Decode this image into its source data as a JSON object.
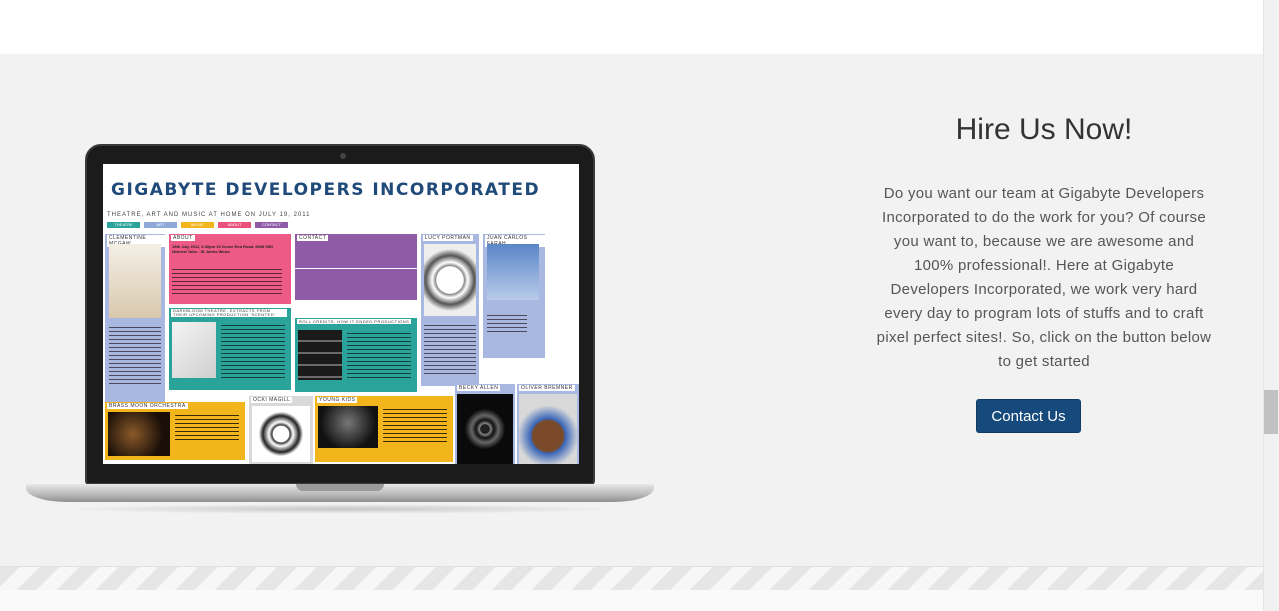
{
  "hire": {
    "title": "Hire Us Now!",
    "text": "Do you want our team at Gigabyte Developers Incorporated to do the work for you? Of course you want to, because we are awesome and 100% professional!. Here at Gigabyte Developers Incorporated, we work very hard every day to program lots of stuffs and to craft pixel perfect sites!. So, click on the button below to get started",
    "button_label": "Contact Us",
    "button_color": "#174a7c"
  },
  "laptop_screen": {
    "site_title": "Gigabyte Developers Incorporated",
    "subtitle": "THEATRE, ART AND MUSIC AT HOME ON JULY 19, 2011",
    "nav": [
      "THEATRE",
      "ART",
      "MUSIC",
      "ABOUT",
      "CONTACT"
    ],
    "blocks": {
      "clementine": "CLEMENTINE MCGAW",
      "about": "ABOUT",
      "about_text": "19th July 2011, 6.30pm 15 Grove End Road, NW8 9SD Nearest Tube : St Johns Wood",
      "contact": "CONTACT",
      "lucy": "LUCY PORTMAN",
      "juan": "JUAN CARLOS FARAH",
      "darkbloom": "DARKBLOOM THEATRE, EXTRACTS FROM THEIR UPCOMING PRODUCTION 'SCENTED'",
      "roll_credits": "ROLL CREDITS, HOW IT ENDED PRODUCTIONS",
      "brass_moon": "BRASS MOON ORCHESTRA",
      "ocki": "OCKI MAGILL",
      "young_kids": "YOUNG KIDS",
      "becky": "BECKY ALLEN",
      "oliver": "OLIVER BREMNER"
    }
  },
  "icons": {
    "laptop": "laptop-icon"
  }
}
